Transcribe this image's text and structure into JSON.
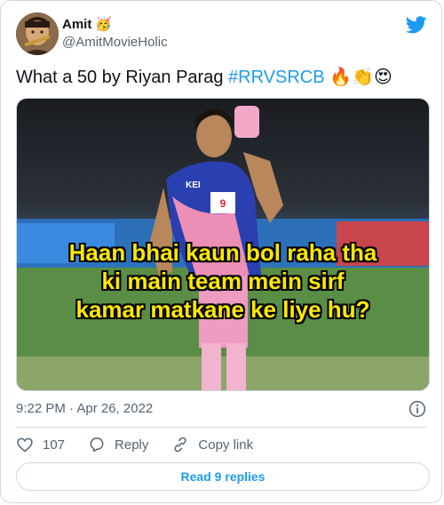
{
  "author": {
    "name": "Amit",
    "name_emoji": "🥳",
    "handle": "@AmitMovieHolic"
  },
  "tweet": {
    "text_prefix": "What a 50 by Riyan Parag ",
    "hashtag": "#RRVSRCB",
    "emojis": "🔥👏😍"
  },
  "media": {
    "jersey_text": "KEI",
    "meme_lines": [
      "Haan bhai kaun bol raha tha",
      "ki main team mein sirf",
      "kamar matkane ke liye hu?"
    ]
  },
  "timestamp": "9:22 PM · Apr 26, 2022",
  "actions": {
    "likes_count": "107",
    "reply_label": "Reply",
    "copy_link_label": "Copy link"
  },
  "replies_button": "Read 9 replies",
  "colors": {
    "accent": "#1d9bf0",
    "meme_text": "#ffe800"
  }
}
